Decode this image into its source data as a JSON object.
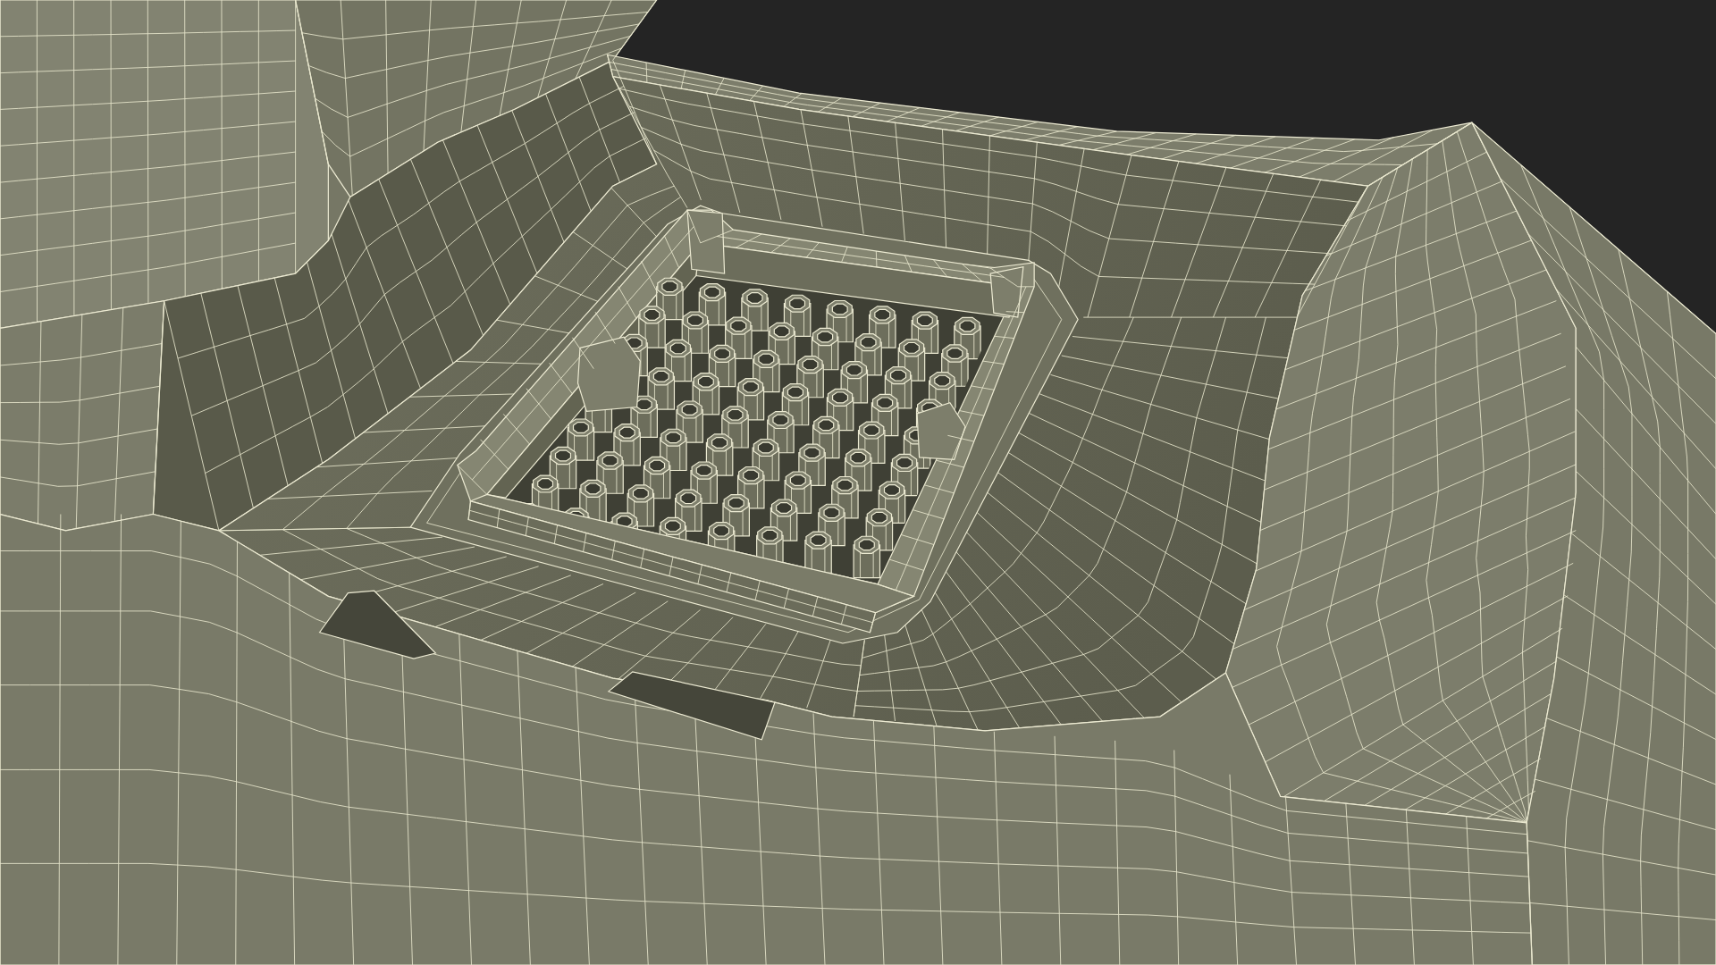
{
  "viewport": {
    "kind": "wireframe-render"
  }
}
